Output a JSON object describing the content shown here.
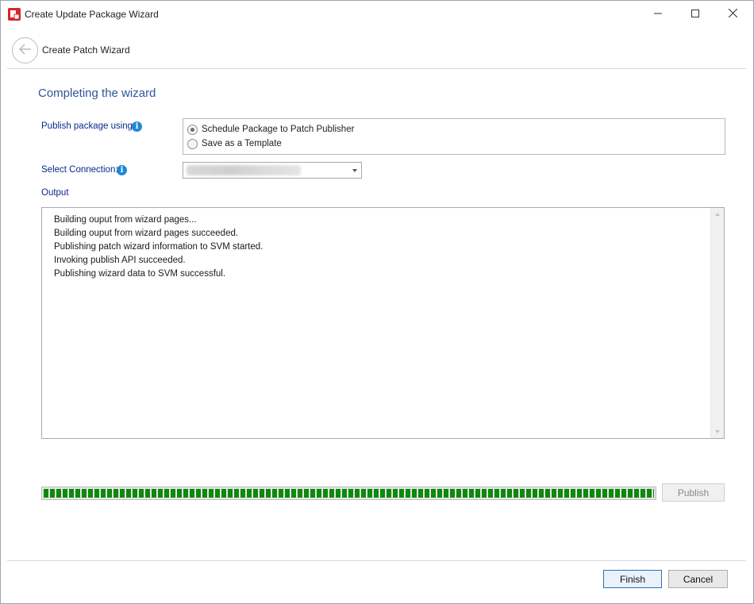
{
  "window": {
    "title": "Create Update Package Wizard",
    "controls": {
      "minimize_icon": "minimize-icon",
      "maximize_icon": "maximize-icon",
      "close_icon": "close-icon"
    }
  },
  "header": {
    "back_icon": "back-arrow-icon",
    "title": "Create Patch Wizard"
  },
  "main": {
    "section_title": "Completing the wizard",
    "publish_label": "Publish package using:",
    "publish_options": [
      {
        "label": "Schedule Package to Patch Publisher",
        "selected": true
      },
      {
        "label": "Save as a Template",
        "selected": false
      }
    ],
    "connection_label": "Select Connection:",
    "connection_value": "",
    "output_label": "Output",
    "output_lines": [
      "Building ouput from wizard pages...",
      "Building ouput from wizard pages succeeded.",
      "Publishing patch wizard information to SVM started.",
      "Invoking publish API succeeded.",
      "Publishing wizard data to SVM successful."
    ],
    "progress_fraction": 1.0,
    "publish_button": "Publish"
  },
  "footer": {
    "finish_button": "Finish",
    "cancel_button": "Cancel"
  },
  "colors": {
    "section_title": "#2f5597",
    "label": "#0b2a8a",
    "info_icon": "#1e88d6",
    "progress": "#0b8a0b"
  }
}
